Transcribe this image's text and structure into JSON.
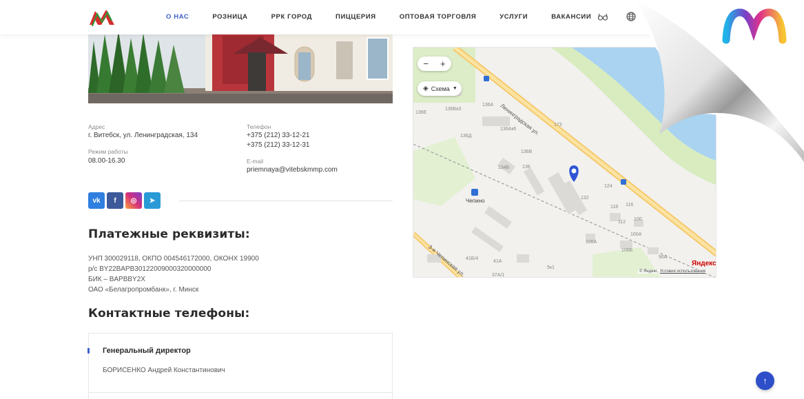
{
  "header": {
    "nav": [
      {
        "label": "О нас",
        "active": true
      },
      {
        "label": "Розница",
        "active": false
      },
      {
        "label": "РРК Город",
        "active": false
      },
      {
        "label": "Пиццерия",
        "active": false
      },
      {
        "label": "Оптовая торговля",
        "active": false
      },
      {
        "label": "Услуги",
        "active": false
      },
      {
        "label": "Вакансии",
        "active": false
      }
    ],
    "icons": [
      "glasses-icon",
      "globe-icon"
    ],
    "accent_color": "#3b5ec9"
  },
  "contacts": {
    "address_label": "Адрес",
    "address_value": "г. Витебск, ул. Ленинградская, 134",
    "hours_label": "Режим работы",
    "hours_value": "08.00-16.30",
    "phone_label": "Телефон",
    "phone_1": "+375 (212) 33-12-21",
    "phone_2": "+375 (212) 33-12-31",
    "email_label": "E-mail",
    "email_value": "priemnaya@vitebskmmp.com"
  },
  "social": [
    {
      "name": "vk",
      "label": "vk",
      "color": "#2f7fe0"
    },
    {
      "name": "facebook",
      "label": "f",
      "color": "#3c5a9a"
    },
    {
      "name": "instagram",
      "label": "◎",
      "color": "#d6307a"
    },
    {
      "name": "telegram",
      "label": "➤",
      "color": "#2a9ad6"
    }
  ],
  "payment": {
    "title": "Платежные реквизиты:",
    "lines": [
      "УНП 300029118, ОКПО 004546172000, ОКОНХ 19900",
      "р/с BY22BAPB30122009000320000000",
      "БИК –  BAPBBY2X",
      "ОАО «Белагропромбанк», г. Минск"
    ]
  },
  "phones_section": {
    "title": "Контактные телефоны:",
    "entry_title": "Генеральный директор",
    "entry_name": "БОРИСЕНКО Андрей Константинович"
  },
  "map": {
    "zoom_out": "−",
    "zoom_in": "+",
    "layer_label": "Схема",
    "road_1": "Ленинградская ул.",
    "road_2": "3-я Чепинская ул.",
    "station": "Чепино",
    "yandex": "Яндекс",
    "copyright": "© Яндекс",
    "terms": "Условия использования",
    "house_numbers": [
      "136E",
      "136Бк3",
      "136A",
      "136Ак6",
      "136Д",
      "136В",
      "134Б",
      "136",
      "124",
      "173",
      "132",
      "118",
      "116",
      "112",
      "100",
      "100А",
      "106А",
      "106Б",
      "90А",
      "41Б/4",
      "41А",
      "5к1",
      "37А/1"
    ]
  },
  "scroll_top_icon": "arrow-up-icon"
}
